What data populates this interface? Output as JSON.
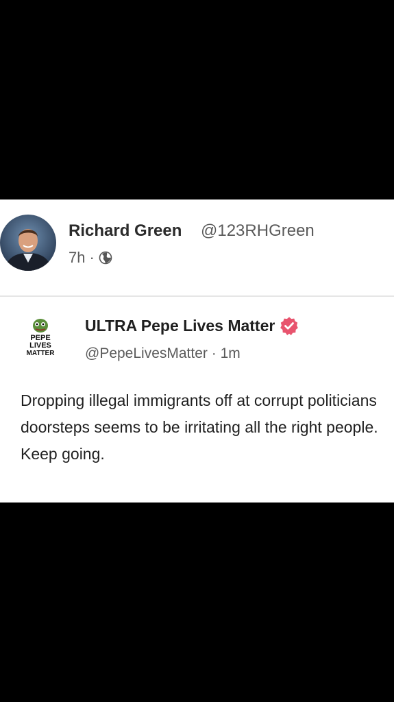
{
  "post": {
    "author_name": "Richard Green",
    "author_handle": "@123RHGreen",
    "time_ago": "7h",
    "separator": "·",
    "visibility_icon": "globe-icon"
  },
  "quote": {
    "author_name": "ULTRA Pepe Lives Matter",
    "verified_icon": "verified-badge-icon",
    "author_handle": "@PepeLivesMatter",
    "separator": "·",
    "time_ago": "1m",
    "logo_text": [
      "PEPE",
      "LIVES",
      "MATTER"
    ],
    "body": [
      "Dropping illegal immigrants off at corrupt politicians doorsteps seems to be irritating all the right people.",
      "Keep going."
    ]
  },
  "colors": {
    "background": "#000000",
    "card": "#ffffff",
    "verified_badge": "#e8546e",
    "text_primary": "#1f1f1f",
    "text_secondary": "#5a5a5a"
  }
}
